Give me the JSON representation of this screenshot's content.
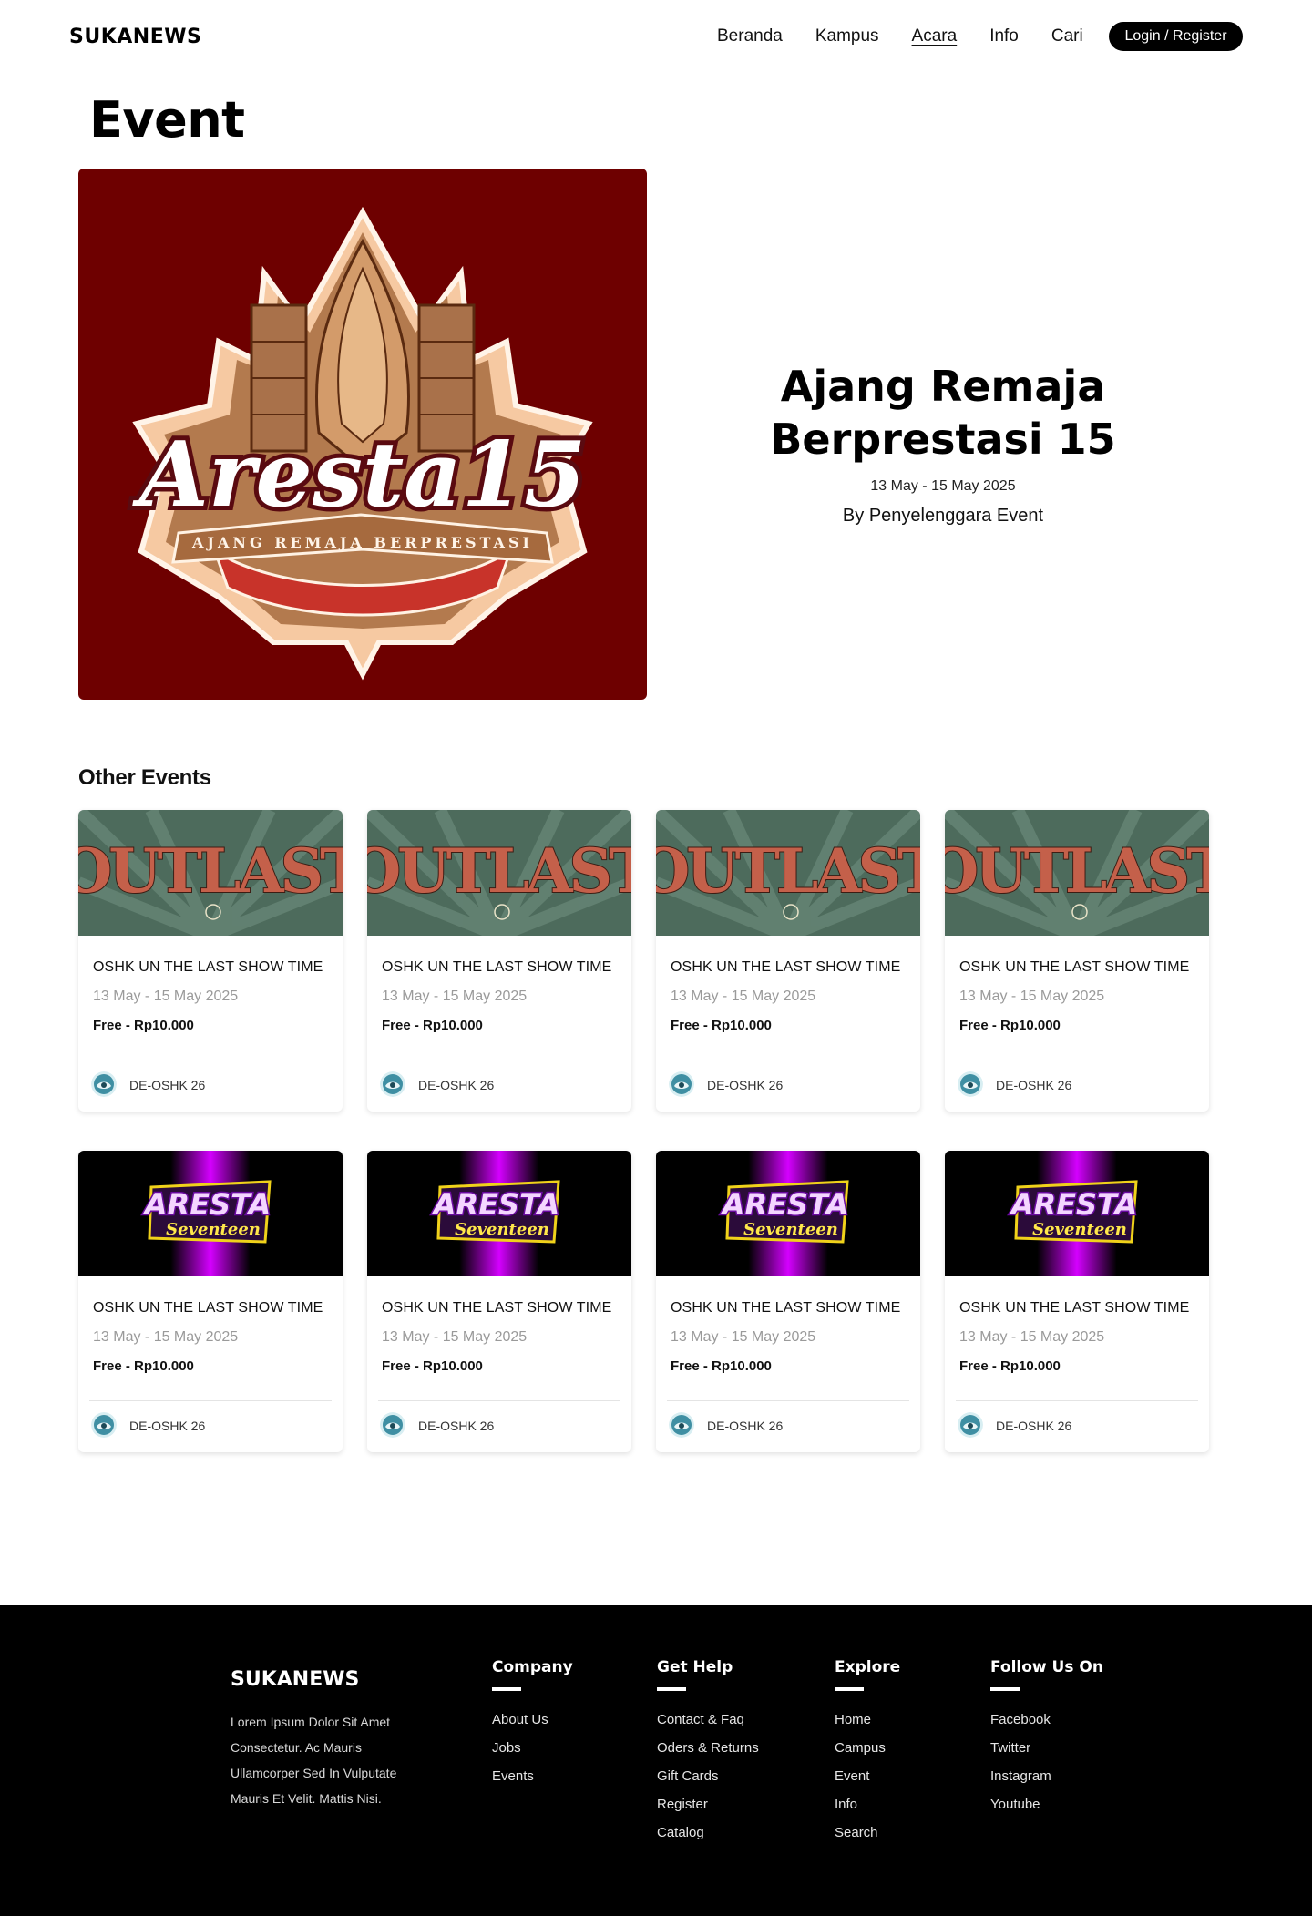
{
  "header": {
    "logo": "SUKANEWS",
    "nav": [
      "Beranda",
      "Kampus",
      "Acara",
      "Info",
      "Cari"
    ],
    "active_nav": "Acara",
    "login_label": "Login / Register"
  },
  "page_title": "Event",
  "hero": {
    "image_text": "Aresta15",
    "image_subtitle": "AJANG REMAJA BERPRESTASI",
    "title": "Ajang Remaja Berprestasi 15",
    "date": "13 May - 15 May 2025",
    "by": "By Penyelenggara Event"
  },
  "other_events": {
    "title": "Other Events",
    "cards": [
      {
        "image": "outlast",
        "image_text": "OUTLAST",
        "title": "OSHK UN THE LAST SHOW TIME",
        "date": "13 May - 15 May 2025",
        "price": "Free - Rp10.000",
        "organizer": "DE-OSHK 26"
      },
      {
        "image": "outlast",
        "image_text": "OUTLAST",
        "title": "OSHK UN THE LAST SHOW TIME",
        "date": "13 May - 15 May 2025",
        "price": "Free - Rp10.000",
        "organizer": "DE-OSHK 26"
      },
      {
        "image": "outlast",
        "image_text": "OUTLAST",
        "title": "OSHK UN THE LAST SHOW TIME",
        "date": "13 May - 15 May 2025",
        "price": "Free - Rp10.000",
        "organizer": "DE-OSHK 26"
      },
      {
        "image": "outlast",
        "image_text": "OUTLAST",
        "title": "OSHK UN THE LAST SHOW TIME",
        "date": "13 May - 15 May 2025",
        "price": "Free - Rp10.000",
        "organizer": "DE-OSHK 26"
      },
      {
        "image": "aresta",
        "image_text": "ARESTA",
        "image_text2": "Seventeen",
        "title": "OSHK UN THE LAST SHOW TIME",
        "date": "13 May - 15 May 2025",
        "price": "Free - Rp10.000",
        "organizer": "DE-OSHK 26"
      },
      {
        "image": "aresta",
        "image_text": "ARESTA",
        "image_text2": "Seventeen",
        "title": "OSHK UN THE LAST SHOW TIME",
        "date": "13 May - 15 May 2025",
        "price": "Free - Rp10.000",
        "organizer": "DE-OSHK 26"
      },
      {
        "image": "aresta",
        "image_text": "ARESTA",
        "image_text2": "Seventeen",
        "title": "OSHK UN THE LAST SHOW TIME",
        "date": "13 May - 15 May 2025",
        "price": "Free - Rp10.000",
        "organizer": "DE-OSHK 26"
      },
      {
        "image": "aresta",
        "image_text": "ARESTA",
        "image_text2": "Seventeen",
        "title": "OSHK UN THE LAST SHOW TIME",
        "date": "13 May - 15 May 2025",
        "price": "Free - Rp10.000",
        "organizer": "DE-OSHK 26"
      }
    ]
  },
  "footer": {
    "logo": "SUKANEWS",
    "description": "Lorem Ipsum Dolor Sit Amet Consectetur. Ac Mauris Ullamcorper Sed In Vulputate Mauris Et Velit. Mattis Nisi.",
    "columns": [
      {
        "title": "Company",
        "links": [
          "About Us",
          "Jobs",
          "Events"
        ]
      },
      {
        "title": "Get Help",
        "links": [
          "Contact & Faq",
          "Oders & Returns",
          "Gift Cards",
          "Register",
          "Catalog"
        ]
      },
      {
        "title": "Explore",
        "links": [
          "Home",
          "Campus",
          "Event",
          "Info",
          "Search"
        ]
      },
      {
        "title": "Follow Us On",
        "links": [
          "Facebook",
          "Twitter",
          "Instagram",
          "Youtube"
        ]
      }
    ]
  },
  "colors": {
    "hero_bg": "#6e0000",
    "outlast_bg": "#4d6b5c",
    "outlast_text": "#c4604a",
    "aresta_glow": "#d400ff",
    "footer_bg": "#000000"
  }
}
